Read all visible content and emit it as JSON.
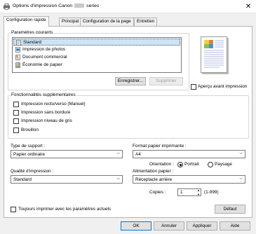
{
  "window": {
    "title_prefix": "Options d'impression Canon",
    "title_suffix": "series",
    "close": "✕"
  },
  "tabs": [
    {
      "label": "Configuration rapide"
    },
    {
      "label": "Principal"
    },
    {
      "label": "Configuration de la page"
    },
    {
      "label": "Entretien"
    }
  ],
  "parametres_courants": {
    "label": "Paramètres courants",
    "items": [
      "Standard",
      "Impression de photos",
      "Document commercial",
      "Économie de papier"
    ],
    "selected": 0,
    "save_button": "Enregistrer...",
    "delete_button": "Supprimer"
  },
  "apercu": {
    "label": "Aperçu avant impression",
    "checked": false
  },
  "fonctionnalites": {
    "label": "Fonctionnalités supplémentaires",
    "items": [
      "Impression recto/verso (Manuel)",
      "Impression sans bordure",
      "Impression niveau de gris",
      "Brouillon"
    ]
  },
  "type_support": {
    "label": "Type de support :",
    "value": "Papier ordinaire"
  },
  "format_papier": {
    "label": "Format papier imprimante :",
    "value": "A4"
  },
  "orientation": {
    "label": "Orientation :",
    "portrait": "Portrait",
    "paysage": "Paysage",
    "selected": "portrait"
  },
  "qualite": {
    "label": "Qualité d'impression :",
    "value": "Standard"
  },
  "alimentation": {
    "label": "Alimentation papier :",
    "value": "Réceptacle arrière"
  },
  "copies": {
    "label": "Copies :",
    "value": "1",
    "range": "(1-999)"
  },
  "toujours": {
    "label": "Toujours imprimer avec les paramètres actuels",
    "checked": false
  },
  "defaut_button": "Défaut",
  "footer": {
    "ok": "OK",
    "cancel": "Annuler",
    "apply": "Appliquer",
    "help": "Aide"
  },
  "colors": {
    "accent": "#0078d7",
    "selection": "#cce4f7",
    "panel": "#ffffff",
    "dialog": "#f0f0f0"
  }
}
